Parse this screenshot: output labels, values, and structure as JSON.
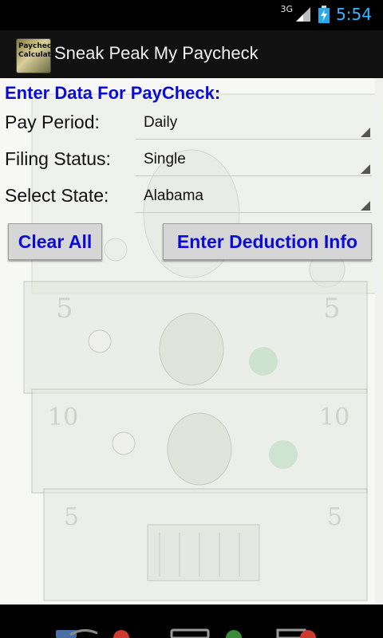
{
  "status_bar": {
    "network": "3G",
    "time": "5:54"
  },
  "action_bar": {
    "icon_text": "Paycheck Calculator",
    "title": "Sneak Peak My Paycheck"
  },
  "form": {
    "heading": "Enter Data For PayCheck:",
    "pay_period": {
      "label": "Pay Period:",
      "value": "Daily"
    },
    "filing_status": {
      "label": "Filing Status:",
      "value": "Single"
    },
    "state": {
      "label": "Select State:",
      "value": "Alabama"
    }
  },
  "buttons": {
    "clear": "Clear All",
    "deduction": "Enter Deduction Info"
  },
  "colors": {
    "accent_blue": "#0b0bd6",
    "clock_blue": "#38b6ff",
    "background": "#f7f7f5"
  }
}
